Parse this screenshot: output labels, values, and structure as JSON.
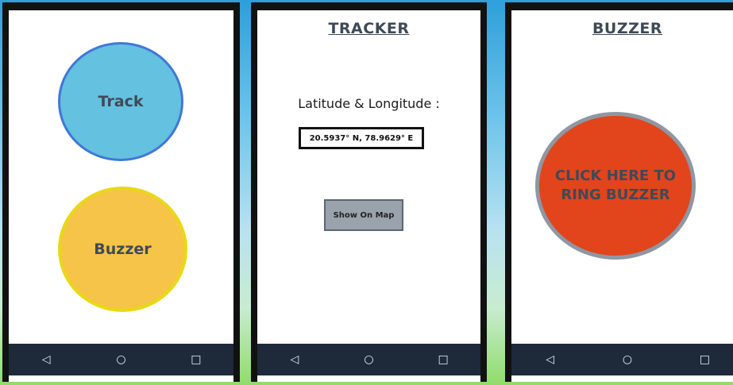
{
  "screens": {
    "home": {
      "track_label": "Track",
      "buzzer_label": "Buzzer"
    },
    "tracker": {
      "title": "TRACKER",
      "latlong_label": "Latitude & Longitude :",
      "coordinates": "20.5937° N, 78.9629° E",
      "show_map_label": "Show On Map"
    },
    "buzzer": {
      "title": "BUZZER",
      "ring_label": "CLICK HERE TO RING BUZZER"
    }
  },
  "navbar": {
    "back": "◁",
    "home": "○",
    "recents": "□"
  },
  "colors": {
    "track": "#64c1df",
    "buzzer": "#f5c448",
    "ring": "#e2441c",
    "navbar": "#1e2a3a"
  }
}
